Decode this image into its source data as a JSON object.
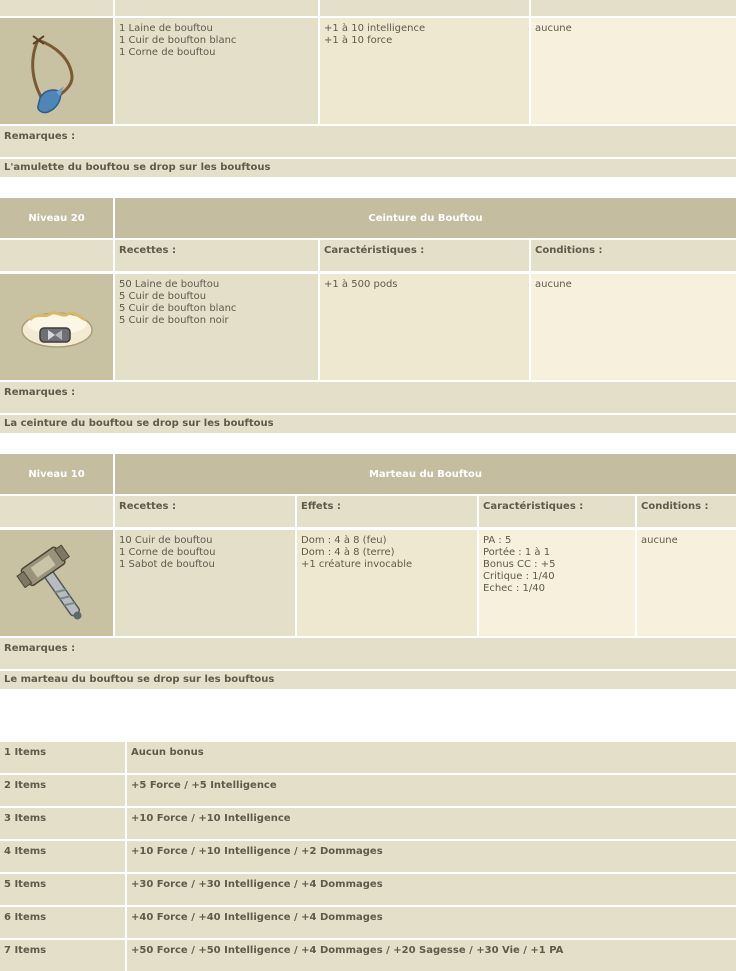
{
  "amulette": {
    "recipe": "1 Laine de bouftou\n1 Cuir de boufton blanc\n1 Corne de bouftou",
    "characteristics": "+1 à 10 intelligence\n+1 à 10 force",
    "conditions": "aucune",
    "remarks_label": "Remarques :",
    "remark": "L'amulette du bouftou se drop sur les bouftous"
  },
  "ceinture": {
    "level": "Niveau 20",
    "name": "Ceinture du Bouftou",
    "headers": {
      "recipes": "Recettes :",
      "characteristics": "Caractéristiques :",
      "conditions": "Conditions :"
    },
    "recipe": "50 Laine de bouftou\n5 Cuir de bouftou\n5 Cuir de boufton blanc\n5 Cuir de boufton noir",
    "characteristics": "+1 à 500 pods",
    "conditions": "aucune",
    "remarks_label": "Remarques :",
    "remark": "La ceinture du bouftou se drop sur les bouftous"
  },
  "marteau": {
    "level": "Niveau 10",
    "name": "Marteau du Bouftou",
    "headers": {
      "recipes": "Recettes :",
      "effects": "Effets :",
      "characteristics": "Caractéristiques :",
      "conditions": "Conditions :"
    },
    "recipe": "10 Cuir de bouftou\n1 Corne de bouftou\n1 Sabot de bouftou",
    "effects": "Dom : 4 à 8 (feu)\nDom : 4 à 8 (terre)\n+1 créature invocable",
    "characteristics": "PA : 5\nPortée : 1 à 1\nBonus CC : +5\nCritique : 1/40\nEchec : 1/40",
    "conditions": "aucune",
    "remarks_label": "Remarques :",
    "remark": "Le marteau du bouftou se drop sur les bouftous"
  },
  "set_bonuses": [
    {
      "items": "1 Items",
      "bonus": "Aucun bonus"
    },
    {
      "items": "2 Items",
      "bonus": "+5 Force / +5 Intelligence"
    },
    {
      "items": "3 Items",
      "bonus": "+10 Force / +10 Intelligence"
    },
    {
      "items": "4 Items",
      "bonus": "+10 Force / +10 Intelligence / +2 Dommages"
    },
    {
      "items": "5 Items",
      "bonus": "+30 Force / +30 Intelligence / +4 Dommages"
    },
    {
      "items": "6 Items",
      "bonus": "+40 Force / +40 Intelligence / +4 Dommages"
    },
    {
      "items": "7 Items",
      "bonus": "+50 Force / +50 Intelligence / +4 Dommages / +20 Sagesse / +30 Vie / +1 PA"
    }
  ],
  "icons": {
    "amulette": "amulet-icon",
    "ceinture": "belt-icon",
    "marteau": "hammer-icon"
  }
}
